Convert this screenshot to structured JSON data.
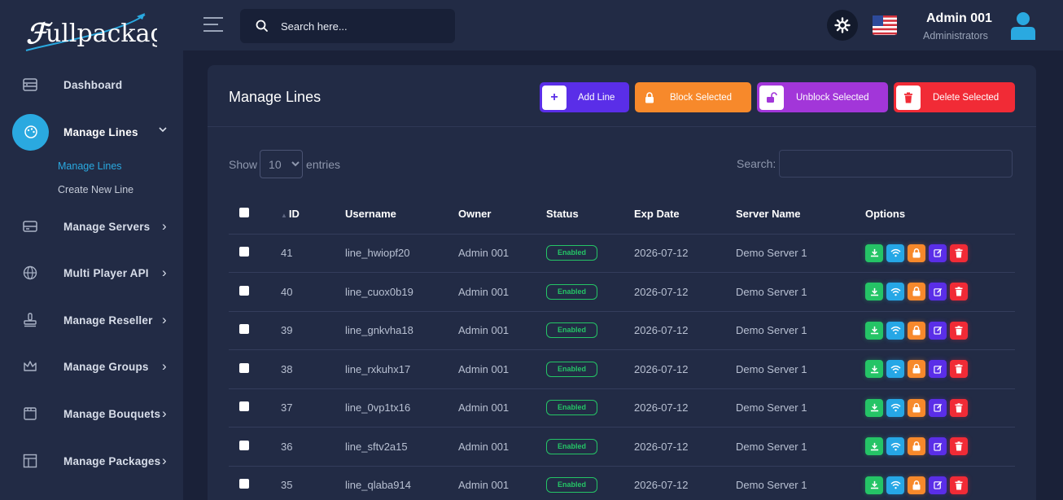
{
  "brand": {
    "logo_text": "Fullpackage"
  },
  "sidebar": {
    "items": [
      {
        "label": "Dashboard",
        "icon": "dashboard-icon",
        "chevron": false
      },
      {
        "label": "Manage Lines",
        "icon": "palette-icon",
        "chevron": true,
        "active": true,
        "sub": [
          {
            "label": "Manage Lines",
            "current": true
          },
          {
            "label": "Create New Line"
          }
        ]
      },
      {
        "label": "Manage Servers",
        "icon": "server-icon",
        "chevron": true
      },
      {
        "label": "Multi Player API",
        "icon": "globe-icon",
        "chevron": true
      },
      {
        "label": "Manage Reseller",
        "icon": "stamp-icon",
        "chevron": true
      },
      {
        "label": "Manage Groups",
        "icon": "crown-icon",
        "chevron": true
      },
      {
        "label": "Manage Bouquets",
        "icon": "film-icon",
        "chevron": true
      },
      {
        "label": "Manage Packages",
        "icon": "layout-icon",
        "chevron": true
      }
    ],
    "chevron_right": "›",
    "chevron_down": "⌄"
  },
  "header": {
    "search_placeholder": "Search here...",
    "user_name": "Admin 001",
    "user_role": "Administrators"
  },
  "card": {
    "title": "Manage Lines",
    "actions": [
      {
        "label": "Add Line",
        "color": "#5a2ee8",
        "icon": "plus-icon",
        "glyph": "+"
      },
      {
        "label": "Block Selected",
        "color": "#f7892b",
        "icon": "lock-icon"
      },
      {
        "label": "Unblock Selected",
        "color": "#a236d9",
        "icon": "unlock-icon"
      },
      {
        "label": "Delete Selected",
        "color": "#f12b36",
        "icon": "trash-icon"
      }
    ],
    "show_label": "Show",
    "entries_label": "entries",
    "page_size": "10",
    "search_label": "Search:"
  },
  "table": {
    "columns": [
      "",
      "ID",
      "Username",
      "Owner",
      "Status",
      "Exp Date",
      "Server Name",
      "Options"
    ],
    "rows": [
      {
        "id": "41",
        "username": "line_hwiopf20",
        "owner": "Admin 001",
        "status": "Enabled",
        "exp": "2026-07-12",
        "server": "Demo Server 1"
      },
      {
        "id": "40",
        "username": "line_cuox0b19",
        "owner": "Admin 001",
        "status": "Enabled",
        "exp": "2026-07-12",
        "server": "Demo Server 1"
      },
      {
        "id": "39",
        "username": "line_gnkvha18",
        "owner": "Admin 001",
        "status": "Enabled",
        "exp": "2026-07-12",
        "server": "Demo Server 1"
      },
      {
        "id": "38",
        "username": "line_rxkuhx17",
        "owner": "Admin 001",
        "status": "Enabled",
        "exp": "2026-07-12",
        "server": "Demo Server 1"
      },
      {
        "id": "37",
        "username": "line_0vp1tx16",
        "owner": "Admin 001",
        "status": "Enabled",
        "exp": "2026-07-12",
        "server": "Demo Server 1"
      },
      {
        "id": "36",
        "username": "line_sftv2a15",
        "owner": "Admin 001",
        "status": "Enabled",
        "exp": "2026-07-12",
        "server": "Demo Server 1"
      },
      {
        "id": "35",
        "username": "line_qlaba914",
        "owner": "Admin 001",
        "status": "Enabled",
        "exp": "2026-07-12",
        "server": "Demo Server 1"
      }
    ],
    "option_buttons": [
      {
        "icon": "download-icon",
        "color": "#25c466"
      },
      {
        "icon": "wifi-icon",
        "color": "#26a7e6"
      },
      {
        "icon": "lock-icon",
        "color": "#f7892b"
      },
      {
        "icon": "edit-icon",
        "color": "#5a2ee8"
      },
      {
        "icon": "trash-icon",
        "color": "#f12b36"
      }
    ]
  }
}
